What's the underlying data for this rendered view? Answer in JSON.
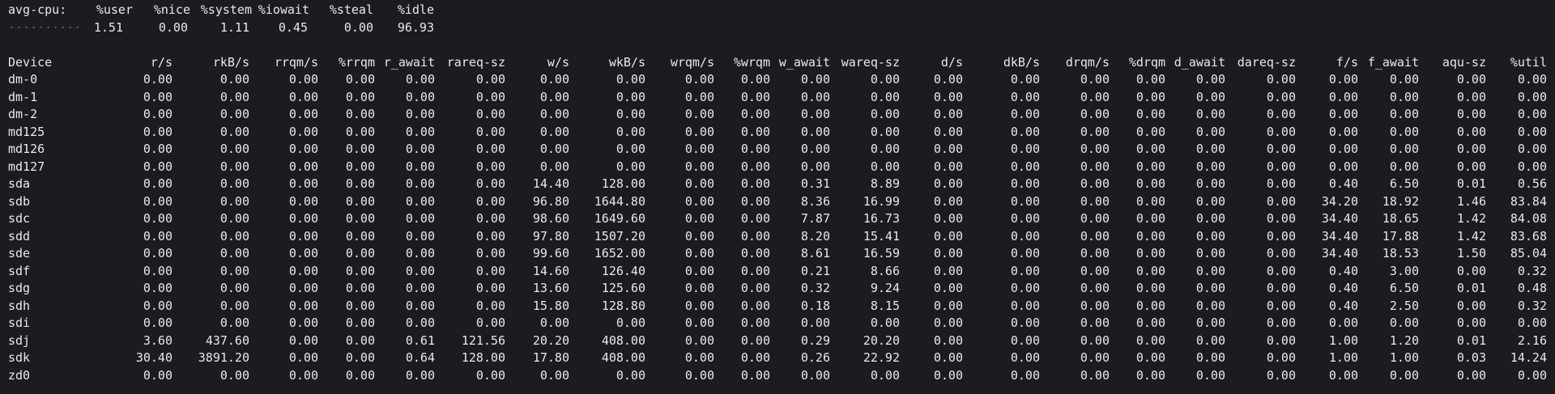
{
  "cpu": {
    "label": "avg-cpu:",
    "headers": [
      "%user",
      "%nice",
      "%system",
      "%iowait",
      "%steal",
      "%idle"
    ],
    "values": [
      "1.51",
      "0.00",
      "1.11",
      "0.45",
      "0.00",
      "96.93"
    ],
    "leader": "··········"
  },
  "device_table": {
    "headers": [
      "Device",
      "r/s",
      "rkB/s",
      "rrqm/s",
      "%rrqm",
      "r_await",
      "rareq-sz",
      "w/s",
      "wkB/s",
      "wrqm/s",
      "%wrqm",
      "w_await",
      "wareq-sz",
      "d/s",
      "dkB/s",
      "drqm/s",
      "%drqm",
      "d_await",
      "dareq-sz",
      "f/s",
      "f_await",
      "aqu-sz",
      "%util"
    ],
    "rows": [
      [
        "dm-0",
        "0.00",
        "0.00",
        "0.00",
        "0.00",
        "0.00",
        "0.00",
        "0.00",
        "0.00",
        "0.00",
        "0.00",
        "0.00",
        "0.00",
        "0.00",
        "0.00",
        "0.00",
        "0.00",
        "0.00",
        "0.00",
        "0.00",
        "0.00",
        "0.00",
        "0.00"
      ],
      [
        "dm-1",
        "0.00",
        "0.00",
        "0.00",
        "0.00",
        "0.00",
        "0.00",
        "0.00",
        "0.00",
        "0.00",
        "0.00",
        "0.00",
        "0.00",
        "0.00",
        "0.00",
        "0.00",
        "0.00",
        "0.00",
        "0.00",
        "0.00",
        "0.00",
        "0.00",
        "0.00"
      ],
      [
        "dm-2",
        "0.00",
        "0.00",
        "0.00",
        "0.00",
        "0.00",
        "0.00",
        "0.00",
        "0.00",
        "0.00",
        "0.00",
        "0.00",
        "0.00",
        "0.00",
        "0.00",
        "0.00",
        "0.00",
        "0.00",
        "0.00",
        "0.00",
        "0.00",
        "0.00",
        "0.00"
      ],
      [
        "md125",
        "0.00",
        "0.00",
        "0.00",
        "0.00",
        "0.00",
        "0.00",
        "0.00",
        "0.00",
        "0.00",
        "0.00",
        "0.00",
        "0.00",
        "0.00",
        "0.00",
        "0.00",
        "0.00",
        "0.00",
        "0.00",
        "0.00",
        "0.00",
        "0.00",
        "0.00"
      ],
      [
        "md126",
        "0.00",
        "0.00",
        "0.00",
        "0.00",
        "0.00",
        "0.00",
        "0.00",
        "0.00",
        "0.00",
        "0.00",
        "0.00",
        "0.00",
        "0.00",
        "0.00",
        "0.00",
        "0.00",
        "0.00",
        "0.00",
        "0.00",
        "0.00",
        "0.00",
        "0.00"
      ],
      [
        "md127",
        "0.00",
        "0.00",
        "0.00",
        "0.00",
        "0.00",
        "0.00",
        "0.00",
        "0.00",
        "0.00",
        "0.00",
        "0.00",
        "0.00",
        "0.00",
        "0.00",
        "0.00",
        "0.00",
        "0.00",
        "0.00",
        "0.00",
        "0.00",
        "0.00",
        "0.00"
      ],
      [
        "sda",
        "0.00",
        "0.00",
        "0.00",
        "0.00",
        "0.00",
        "0.00",
        "14.40",
        "128.00",
        "0.00",
        "0.00",
        "0.31",
        "8.89",
        "0.00",
        "0.00",
        "0.00",
        "0.00",
        "0.00",
        "0.00",
        "0.40",
        "6.50",
        "0.01",
        "0.56"
      ],
      [
        "sdb",
        "0.00",
        "0.00",
        "0.00",
        "0.00",
        "0.00",
        "0.00",
        "96.80",
        "1644.80",
        "0.00",
        "0.00",
        "8.36",
        "16.99",
        "0.00",
        "0.00",
        "0.00",
        "0.00",
        "0.00",
        "0.00",
        "34.20",
        "18.92",
        "1.46",
        "83.84"
      ],
      [
        "sdc",
        "0.00",
        "0.00",
        "0.00",
        "0.00",
        "0.00",
        "0.00",
        "98.60",
        "1649.60",
        "0.00",
        "0.00",
        "7.87",
        "16.73",
        "0.00",
        "0.00",
        "0.00",
        "0.00",
        "0.00",
        "0.00",
        "34.40",
        "18.65",
        "1.42",
        "84.08"
      ],
      [
        "sdd",
        "0.00",
        "0.00",
        "0.00",
        "0.00",
        "0.00",
        "0.00",
        "97.80",
        "1507.20",
        "0.00",
        "0.00",
        "8.20",
        "15.41",
        "0.00",
        "0.00",
        "0.00",
        "0.00",
        "0.00",
        "0.00",
        "34.40",
        "17.88",
        "1.42",
        "83.68"
      ],
      [
        "sde",
        "0.00",
        "0.00",
        "0.00",
        "0.00",
        "0.00",
        "0.00",
        "99.60",
        "1652.00",
        "0.00",
        "0.00",
        "8.61",
        "16.59",
        "0.00",
        "0.00",
        "0.00",
        "0.00",
        "0.00",
        "0.00",
        "34.40",
        "18.53",
        "1.50",
        "85.04"
      ],
      [
        "sdf",
        "0.00",
        "0.00",
        "0.00",
        "0.00",
        "0.00",
        "0.00",
        "14.60",
        "126.40",
        "0.00",
        "0.00",
        "0.21",
        "8.66",
        "0.00",
        "0.00",
        "0.00",
        "0.00",
        "0.00",
        "0.00",
        "0.40",
        "3.00",
        "0.00",
        "0.32"
      ],
      [
        "sdg",
        "0.00",
        "0.00",
        "0.00",
        "0.00",
        "0.00",
        "0.00",
        "13.60",
        "125.60",
        "0.00",
        "0.00",
        "0.32",
        "9.24",
        "0.00",
        "0.00",
        "0.00",
        "0.00",
        "0.00",
        "0.00",
        "0.40",
        "6.50",
        "0.01",
        "0.48"
      ],
      [
        "sdh",
        "0.00",
        "0.00",
        "0.00",
        "0.00",
        "0.00",
        "0.00",
        "15.80",
        "128.80",
        "0.00",
        "0.00",
        "0.18",
        "8.15",
        "0.00",
        "0.00",
        "0.00",
        "0.00",
        "0.00",
        "0.00",
        "0.40",
        "2.50",
        "0.00",
        "0.32"
      ],
      [
        "sdi",
        "0.00",
        "0.00",
        "0.00",
        "0.00",
        "0.00",
        "0.00",
        "0.00",
        "0.00",
        "0.00",
        "0.00",
        "0.00",
        "0.00",
        "0.00",
        "0.00",
        "0.00",
        "0.00",
        "0.00",
        "0.00",
        "0.00",
        "0.00",
        "0.00",
        "0.00"
      ],
      [
        "sdj",
        "3.60",
        "437.60",
        "0.00",
        "0.00",
        "0.61",
        "121.56",
        "20.20",
        "408.00",
        "0.00",
        "0.00",
        "0.29",
        "20.20",
        "0.00",
        "0.00",
        "0.00",
        "0.00",
        "0.00",
        "0.00",
        "1.00",
        "1.20",
        "0.01",
        "2.16"
      ],
      [
        "sdk",
        "30.40",
        "3891.20",
        "0.00",
        "0.00",
        "0.64",
        "128.00",
        "17.80",
        "408.00",
        "0.00",
        "0.00",
        "0.26",
        "22.92",
        "0.00",
        "0.00",
        "0.00",
        "0.00",
        "0.00",
        "0.00",
        "1.00",
        "1.00",
        "0.03",
        "14.24"
      ],
      [
        "zd0",
        "0.00",
        "0.00",
        "0.00",
        "0.00",
        "0.00",
        "0.00",
        "0.00",
        "0.00",
        "0.00",
        "0.00",
        "0.00",
        "0.00",
        "0.00",
        "0.00",
        "0.00",
        "0.00",
        "0.00",
        "0.00",
        "0.00",
        "0.00",
        "0.00",
        "0.00"
      ]
    ]
  }
}
